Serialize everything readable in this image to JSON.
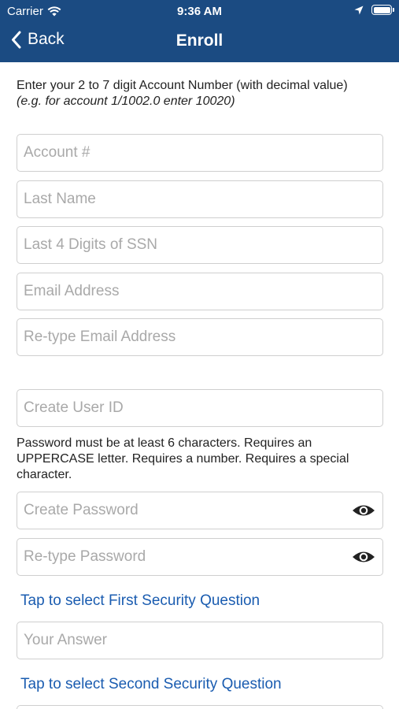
{
  "status_bar": {
    "carrier": "Carrier",
    "time": "9:36 AM"
  },
  "nav": {
    "back_label": "Back",
    "title": "Enroll"
  },
  "intro": {
    "line": "Enter your 2 to 7 digit Account Number (with decimal value)",
    "hint": "(e.g. for account 1/1002.0 enter 10020)"
  },
  "fields": {
    "account": {
      "placeholder": "Account #",
      "value": ""
    },
    "last_name": {
      "placeholder": "Last Name",
      "value": ""
    },
    "ssn": {
      "placeholder": "Last 4 Digits of SSN",
      "value": ""
    },
    "email": {
      "placeholder": "Email Address",
      "value": ""
    },
    "email_confirm": {
      "placeholder": "Re-type Email Address",
      "value": ""
    },
    "user_id": {
      "placeholder": "Create User ID",
      "value": ""
    },
    "password": {
      "placeholder": "Create Password",
      "value": ""
    },
    "password_confirm": {
      "placeholder": "Re-type Password",
      "value": ""
    },
    "answer_1": {
      "placeholder": "Your Answer",
      "value": ""
    }
  },
  "password_note": "Password must be at least 6 characters. Requires an UPPERCASE letter. Requires a number. Requires a special character.",
  "security": {
    "first_question": "Tap to select First Security Question",
    "second_question": "Tap to select Second Security Question"
  },
  "icons": {
    "back": "chevron-left-icon",
    "wifi": "wifi-icon",
    "location": "location-arrow-icon",
    "battery": "battery-icon",
    "show_password": "eye-icon"
  },
  "colors": {
    "header": "#1b4b82",
    "link": "#1a5cb0",
    "field_border": "#cfcfcf",
    "placeholder": "#a9a9a9"
  }
}
